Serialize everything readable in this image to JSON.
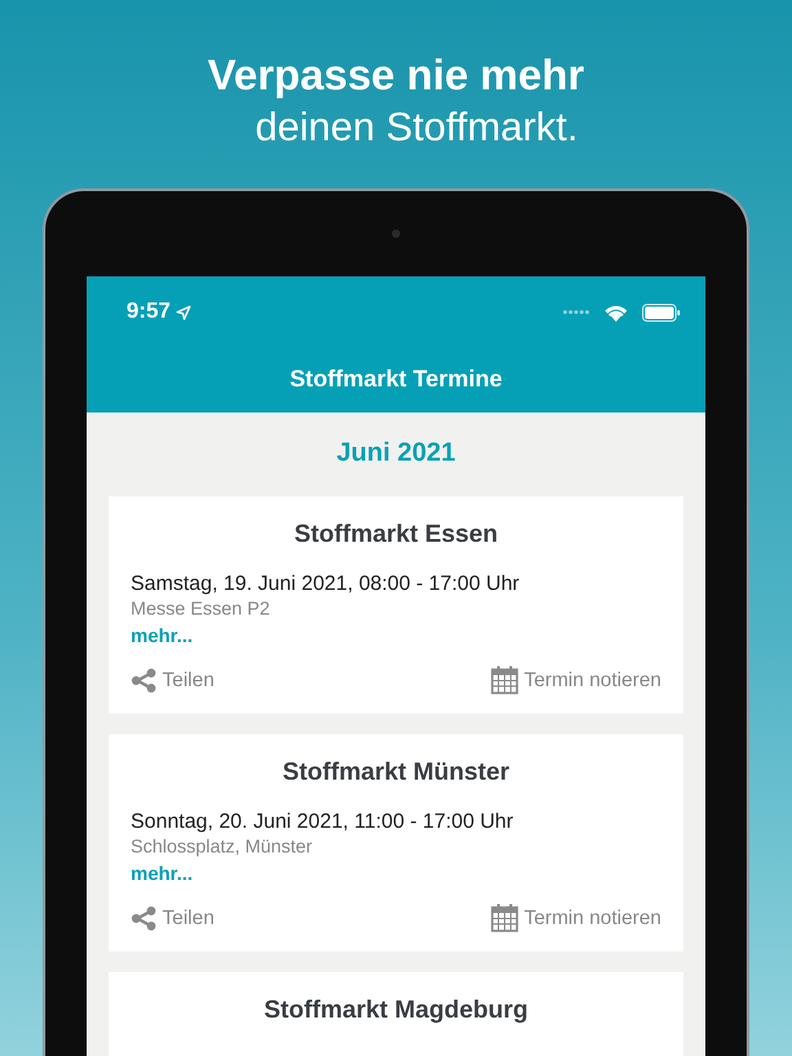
{
  "headline": {
    "line_1": "Verpasse nie mehr",
    "line_2": "deinen Stoffmarkt."
  },
  "status_bar": {
    "time": "9:57"
  },
  "nav_bar": {
    "title": "Stoffmarkt Termine"
  },
  "month": "Juni 2021",
  "events": [
    {
      "title": "Stoffmarkt Essen",
      "date": "Samstag, 19. Juni 2021, 08:00 - 17:00 Uhr",
      "location": "Messe Essen P2",
      "more": "mehr...",
      "share": "Teilen",
      "calendar": "Termin notieren"
    },
    {
      "title": "Stoffmarkt Münster",
      "date": "Sonntag, 20. Juni 2021, 11:00 - 17:00 Uhr",
      "location": "Schlossplatz, Münster",
      "more": "mehr...",
      "share": "Teilen",
      "calendar": "Termin notieren"
    },
    {
      "title": "Stoffmarkt Magdeburg"
    }
  ]
}
